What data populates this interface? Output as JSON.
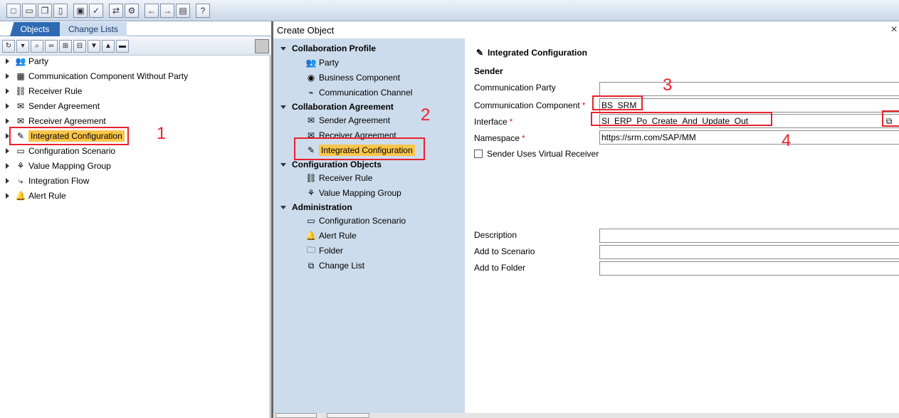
{
  "top_toolbar": {
    "icons": [
      "new-icon",
      "open-icon",
      "copy-icon",
      "delete-icon",
      "multi-copy-icon",
      "check-icon",
      "transfer-icon",
      "settings-icon",
      "back-arrow-icon",
      "forward-arrow-icon",
      "window-icon",
      "help-icon"
    ]
  },
  "left": {
    "tabs": [
      "Objects",
      "Change Lists"
    ],
    "tree": [
      {
        "label": "Party",
        "icon": "party-icon"
      },
      {
        "label": "Communication Component Without Party",
        "icon": "component-icon"
      },
      {
        "label": "Receiver Rule",
        "icon": "receiver-rule-icon"
      },
      {
        "label": "Sender Agreement",
        "icon": "sender-agreement-icon"
      },
      {
        "label": "Receiver Agreement",
        "icon": "receiver-agreement-icon"
      },
      {
        "label": "Integrated Configuration",
        "icon": "integrated-config-icon",
        "selected": true
      },
      {
        "label": "Configuration Scenario",
        "icon": "config-scenario-icon"
      },
      {
        "label": "Value Mapping Group",
        "icon": "value-mapping-icon"
      },
      {
        "label": "Integration Flow",
        "icon": "integration-flow-icon"
      },
      {
        "label": "Alert Rule",
        "icon": "alert-rule-icon"
      }
    ]
  },
  "annotations": {
    "n1": "1",
    "n2": "2",
    "n3": "3",
    "n4": "4"
  },
  "dialog": {
    "title": "Create Object",
    "nav": {
      "groups": [
        {
          "label": "Collaboration Profile",
          "items": [
            "Party",
            "Business Component",
            "Communication Channel"
          ]
        },
        {
          "label": "Collaboration Agreement",
          "items": [
            "Sender Agreement",
            "Receiver Agreement",
            "Integrated Configuration"
          ]
        },
        {
          "label": "Configuration Objects",
          "items": [
            "Receiver Rule",
            "Value Mapping Group"
          ]
        },
        {
          "label": "Administration",
          "items": [
            "Configuration Scenario",
            "Alert Rule",
            "Folder",
            "Change List"
          ]
        }
      ]
    },
    "form": {
      "header": "Integrated Configuration",
      "section": "Sender",
      "communication_party_label": "Communication Party",
      "communication_party_value": "",
      "communication_component_label": "Communication Component",
      "communication_component_value": "BS_SRM",
      "interface_label": "Interface",
      "interface_value": "SI_ERP_Po_Create_And_Update_Out",
      "namespace_label": "Namespace",
      "namespace_value": "https://srm.com/SAP/MM",
      "virtual_receiver_label": "Sender Uses Virtual Receiver",
      "virtual_receiver_checked": false,
      "description_label": "Description",
      "description_value": "",
      "add_to_scenario_label": "Add to Scenario",
      "add_to_scenario_value": "",
      "add_to_folder_label": "Add to Folder",
      "add_to_folder_value": "",
      "required_mark": "*"
    }
  },
  "colors": {
    "selection": "#fbc64a",
    "nav_background": "#cddcec",
    "annotation_red": "#e8232b",
    "tab_active": "#2e6ab3"
  }
}
